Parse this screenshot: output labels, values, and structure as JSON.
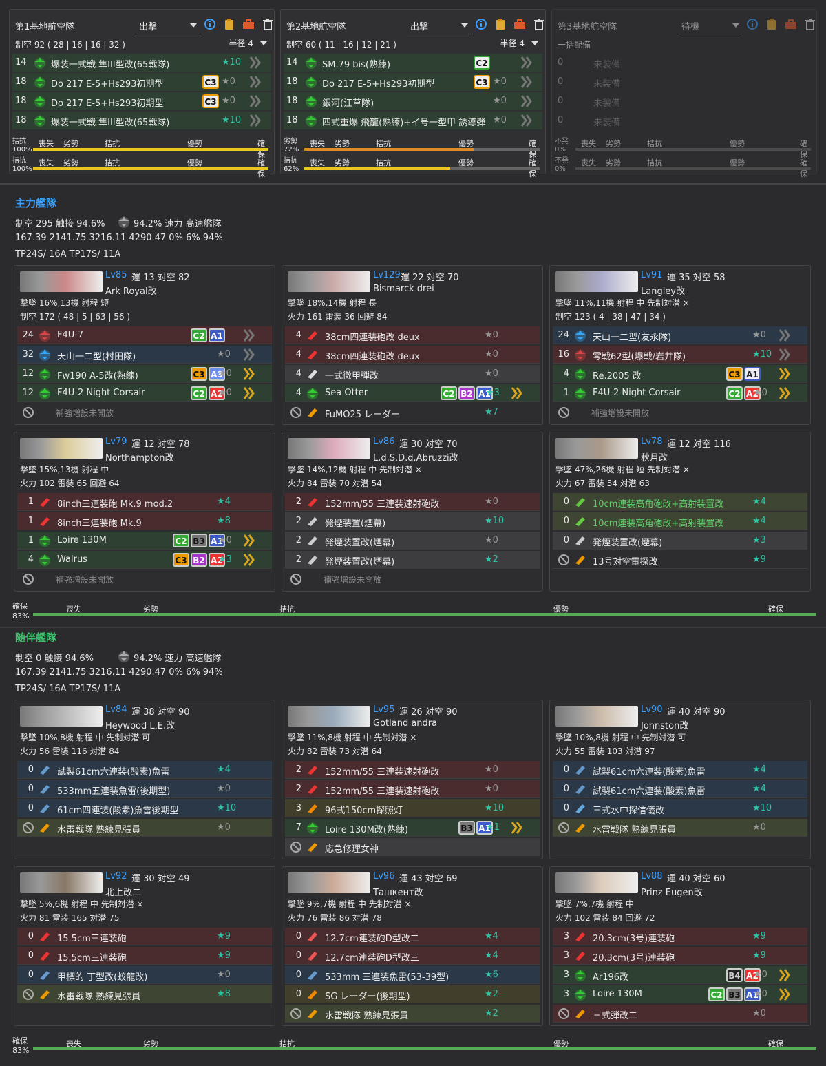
{
  "land_bases": [
    {
      "title": "第1基地航空隊",
      "mode": "出撃",
      "air": "制空 92 ( 28 | 16 | 16 | 32 )",
      "radius": "半径 4",
      "rows": [
        {
          "n": "14",
          "name": "爆装一式戦 隼III型改(65戦隊)",
          "star": "★10",
          "tone": "green",
          "star_color": "#2ec4a5",
          "badges": [],
          "chev": "grey"
        },
        {
          "n": "18",
          "name": "Do 217 E-5+Hs293初期型",
          "star": "★0",
          "tone": "green",
          "star_color": "#999",
          "badges": [
            "C3w"
          ],
          "chev": "grey"
        },
        {
          "n": "18",
          "name": "Do 217 E-5+Hs293初期型",
          "star": "★0",
          "tone": "green",
          "star_color": "#999",
          "badges": [
            "C3w"
          ],
          "chev": "grey"
        },
        {
          "n": "18",
          "name": "爆装一式戦 隼III型改(65戦隊)",
          "star": "★10",
          "tone": "green",
          "star_color": "#2ec4a5",
          "badges": [],
          "chev": "grey"
        }
      ],
      "bars": [
        {
          "label1": "拮抗",
          "label2": "100%",
          "pct": "100%"
        },
        {
          "label1": "拮抗",
          "label2": "100%",
          "pct": "100%"
        }
      ]
    },
    {
      "title": "第2基地航空隊",
      "mode": "出撃",
      "air": "制空 60 ( 11 | 16 | 12 | 21 )",
      "radius": "半径 4",
      "rows": [
        {
          "n": "14",
          "name": "SM.79 bis(熟練)",
          "star": "",
          "tone": "green",
          "star_color": "#999",
          "badges": [
            "C2w"
          ],
          "chev": "grey"
        },
        {
          "n": "18",
          "name": "Do 217 E-5+Hs293初期型",
          "star": "★0",
          "tone": "green",
          "star_color": "#999",
          "badges": [
            "C3w"
          ],
          "chev": "grey"
        },
        {
          "n": "18",
          "name": "銀河(江草隊)",
          "star": "★0",
          "tone": "green",
          "star_color": "#999",
          "badges": [],
          "chev": "grey"
        },
        {
          "n": "18",
          "name": "四式重爆 飛龍(熟練)+イ号一型甲 誘導弾",
          "star": "★0",
          "tone": "green",
          "star_color": "#999",
          "badges": [],
          "chev": "grey"
        }
      ],
      "bars": [
        {
          "label1": "劣勢",
          "label2": "72%",
          "pct": "72%"
        },
        {
          "label1": "拮抗",
          "label2": "62%",
          "pct": "62%"
        }
      ]
    },
    {
      "title": "第3基地航空隊",
      "mode": "待機",
      "air": "一括配備",
      "radius": "",
      "rows": [
        {
          "n": "0",
          "name": "未装備"
        },
        {
          "n": "0",
          "name": "未装備"
        },
        {
          "n": "0",
          "name": "未装備"
        },
        {
          "n": "0",
          "name": "未装備"
        }
      ],
      "bars": [
        {
          "label1": "不発",
          "label2": "0%",
          "pct": "0%"
        },
        {
          "label1": "不発",
          "label2": "0%",
          "pct": "0%"
        }
      ]
    }
  ],
  "bar_ticks": [
    "喪失",
    "劣勢",
    "拮抗",
    "優勢",
    "確保"
  ],
  "fleets": [
    {
      "title": "主力艦隊",
      "line1": "制空 295  触接 94.6%",
      "line1b": "94.2%  速力 高速艦隊",
      "line2": "167.39  2141.75  3216.11  4290.47    0%    6%    94%",
      "line3": "TP24S/ 16A   TP17S/ 11A",
      "bar_label1": "確保",
      "bar_label2": "83%",
      "ships": [
        {
          "lv": "Lv85",
          "stat": "運 13  対空 82",
          "name": "Ark Royal改",
          "l3": "撃墜 16%,13機  射程 短",
          "l4": "制空 172 ( 48 | 5 | 63 | 56 )",
          "pcolor": "#c88",
          "slots": [
            {
              "n": "24",
              "name": "F4U-7",
              "tone": "red",
              "star": "",
              "badges": [
                "C2",
                "A1"
              ],
              "chev": "grey",
              "ic": "#d44"
            },
            {
              "n": "32",
              "name": "天山一二型(村田隊)",
              "tone": "blue",
              "star": "★0",
              "badges": [],
              "chev": "grey",
              "ic": "#3af"
            },
            {
              "n": "12",
              "name": "Fw190 A-5改(熟練)",
              "tone": "green",
              "star": "★0",
              "badges": [
                "C3",
                "A3"
              ],
              "chev": "gold",
              "ic": "#3c3"
            },
            {
              "n": "12",
              "name": "F4U-2 Night Corsair",
              "tone": "green",
              "star": "★0",
              "badges": [
                "C2",
                "A2"
              ],
              "chev": "gold",
              "ic": "#3c3"
            }
          ],
          "ex": "補強増設未開放"
        },
        {
          "lv": "Lv129",
          "stat": "運 22  対空 70",
          "name": "Bismarck drei",
          "l3": "撃墜 18%,14機  射程 長",
          "l4": "火力 161  雷装 36  回避 84",
          "pcolor": "#caa",
          "slots": [
            {
              "n": "4",
              "name": "38cm四連装砲改 deux",
              "tone": "red",
              "star": "★0",
              "badges": [],
              "chev": "",
              "ic": "#e33"
            },
            {
              "n": "4",
              "name": "38cm四連装砲改 deux",
              "tone": "red",
              "star": "★0",
              "badges": [],
              "chev": "",
              "ic": "#e33"
            },
            {
              "n": "4",
              "name": "一式徹甲弾改",
              "tone": "grey",
              "star": "★0",
              "badges": [],
              "chev": "",
              "ic": "#ddd"
            },
            {
              "n": "4",
              "name": "Sea Otter",
              "tone": "green",
              "star": "★3",
              "badges": [
                "C2",
                "B2",
                "A1"
              ],
              "chev": "gold",
              "ic": "#3c3"
            }
          ],
          "ex_name": "FuMO25 レーダー",
          "ex_star": "★7"
        },
        {
          "lv": "Lv91",
          "stat": "運 35  対空 58",
          "name": "Langley改",
          "l3": "撃墜 11%,11機  射程 中  先制対潜 ×",
          "l4": "制空 123 ( 4 | 38 | 47 | 34 )",
          "pcolor": "#aac",
          "slots": [
            {
              "n": "24",
              "name": "天山一二型(友永隊)",
              "tone": "blue",
              "star": "★0",
              "badges": [],
              "chev": "grey",
              "ic": "#3af"
            },
            {
              "n": "16",
              "name": "零戦62型(爆戦/岩井隊)",
              "tone": "red",
              "star": "★10",
              "badges": [],
              "chev": "grey",
              "ic": "#d44"
            },
            {
              "n": "4",
              "name": "Re.2005 改",
              "tone": "green",
              "star": "",
              "badges": [
                "C3",
                "A1w"
              ],
              "chev": "gold",
              "ic": "#3c3"
            },
            {
              "n": "1",
              "name": "F4U-2 Night Corsair",
              "tone": "green",
              "star": "★0",
              "badges": [
                "C2",
                "A2"
              ],
              "chev": "gold",
              "ic": "#3c3"
            }
          ],
          "ex": "補強増設未開放"
        },
        {
          "lv": "Lv79",
          "stat": "運 12  対空 78",
          "name": "Northampton改",
          "l3": "撃墜 15%,13機  射程 中",
          "l4": "火力 102  雷装 65  回避 64",
          "pcolor": "#dc9",
          "slots": [
            {
              "n": "1",
              "name": "8inch三連装砲 Mk.9 mod.2",
              "tone": "red",
              "star": "★4",
              "badges": [],
              "chev": "",
              "ic": "#e33"
            },
            {
              "n": "1",
              "name": "8inch三連装砲 Mk.9",
              "tone": "red",
              "star": "★8",
              "badges": [],
              "chev": "",
              "ic": "#e33"
            },
            {
              "n": "1",
              "name": "Loire 130M",
              "tone": "green",
              "star": "★0",
              "badges": [
                "C2",
                "B3",
                "A1"
              ],
              "chev": "gold",
              "ic": "#3c3"
            },
            {
              "n": "4",
              "name": "Walrus",
              "tone": "green",
              "star": "★3",
              "badges": [
                "C3",
                "B2",
                "A2"
              ],
              "chev": "gold",
              "ic": "#3c3"
            }
          ],
          "ex": "補強増設未開放"
        },
        {
          "lv": "Lv86",
          "stat": "運 30  対空 70",
          "name": "L.d.S.D.d.Abruzzi改",
          "l3": "撃墜 14%,12機  射程 中  先制対潜 ×",
          "l4": "火力 84  雷装 70  対潜 54",
          "pcolor": "#dab",
          "slots": [
            {
              "n": "2",
              "name": "152mm/55 三連装速射砲改",
              "tone": "red",
              "star": "★0",
              "badges": [],
              "chev": "",
              "ic": "#e33"
            },
            {
              "n": "2",
              "name": "発煙装置(煙幕)",
              "tone": "grey",
              "star": "★10",
              "badges": [],
              "chev": "",
              "ic": "#ccc"
            },
            {
              "n": "2",
              "name": "発煙装置改(煙幕)",
              "tone": "grey",
              "star": "★0",
              "badges": [],
              "chev": "",
              "ic": "#ccc"
            },
            {
              "n": "2",
              "name": "発煙装置改(煙幕)",
              "tone": "grey",
              "star": "★2",
              "badges": [],
              "chev": "",
              "ic": "#ccc"
            }
          ],
          "ex": "補強増設未開放"
        },
        {
          "lv": "Lv78",
          "stat": "運 12  対空 116",
          "name": "秋月改",
          "l3": "撃墜 47%,26機  射程 短  先制対潜 ×",
          "l4": "火力 67  雷装 54  対潜 63",
          "pcolor": "#a98",
          "slots": [
            {
              "n": "0",
              "name": "10cm連装高角砲改+高射装置改",
              "tone": "olive",
              "star": "★4",
              "badges": [],
              "chev": "",
              "ic": "#6c4",
              "green": true
            },
            {
              "n": "0",
              "name": "10cm連装高角砲改+高射装置改",
              "tone": "olive",
              "star": "★4",
              "badges": [],
              "chev": "",
              "ic": "#6c4",
              "green": true
            },
            {
              "n": "0",
              "name": "発煙装置改(煙幕)",
              "tone": "grey",
              "star": "★3",
              "badges": [],
              "chev": "",
              "ic": "#ccc"
            }
          ],
          "ex_name": "13号対空電探改",
          "ex_star": "★9"
        }
      ]
    },
    {
      "title": "随伴艦隊",
      "line1": "制空 0  触接 94.6%",
      "line1b": "94.2%  速力 高速艦隊",
      "line2": "167.39  2141.75  3216.11  4290.47    0%    6%    94%",
      "line3": "TP24S/ 16A   TP17S/ 11A",
      "bar_label1": "確保",
      "bar_label2": "83%",
      "ships": [
        {
          "lv": "Lv84",
          "stat": "運 38  対空 90",
          "name": "Heywood L.E.改",
          "l3": "撃墜 10%,8機  射程 中  先制対潜 可",
          "l4": "火力 56  雷装 116  対潜 84",
          "pcolor": "#bbb",
          "slots": [
            {
              "n": "0",
              "name": "試製61cm六連装(酸素)魚雷",
              "tone": "blue",
              "star": "★4",
              "badges": [],
              "chev": "",
              "ic": "#69c"
            },
            {
              "n": "0",
              "name": "533mm五連装魚雷(後期型)",
              "tone": "blue",
              "star": "★0",
              "badges": [],
              "chev": "",
              "ic": "#69c"
            },
            {
              "n": "0",
              "name": "61cm四連装(酸素)魚雷後期型",
              "tone": "blue",
              "star": "★10",
              "badges": [],
              "chev": "",
              "ic": "#69c"
            }
          ],
          "ex_name": "水雷戦隊 熟練見張員",
          "ex_star": "★0",
          "ex_tone": "olive"
        },
        {
          "lv": "Lv95",
          "stat": "運 26  対空 90",
          "name": "Gotland andra",
          "l3": "撃墜 11%,8機  射程 中  先制対潜 ×",
          "l4": "火力 82  雷装 73  対潜 64",
          "pcolor": "#9ab",
          "slots": [
            {
              "n": "2",
              "name": "152mm/55 三連装速射砲改",
              "tone": "red",
              "star": "★0",
              "badges": [],
              "chev": "",
              "ic": "#e33"
            },
            {
              "n": "2",
              "name": "152mm/55 三連装速射砲改",
              "tone": "red",
              "star": "★0",
              "badges": [],
              "chev": "",
              "ic": "#e33"
            },
            {
              "n": "3",
              "name": "96式150cm探照灯",
              "tone": "yel",
              "star": "★10",
              "badges": [],
              "chev": "",
              "ic": "#e80"
            },
            {
              "n": "7",
              "name": "Loire 130M改(熟練)",
              "tone": "green",
              "star": "★1",
              "badges": [
                "B3",
                "A1"
              ],
              "chev": "gold",
              "ic": "#3c3"
            }
          ],
          "ex_name": "応急修理女神",
          "ex_star": "",
          "ex_tone": "grey"
        },
        {
          "lv": "Lv90",
          "stat": "運 40  対空 90",
          "name": "Johnston改",
          "l3": "撃墜 10%,8機  射程 中  先制対潜 可",
          "l4": "火力 55  雷装 103  対潜 97",
          "pcolor": "#cba",
          "slots": [
            {
              "n": "0",
              "name": "試製61cm六連装(酸素)魚雷",
              "tone": "blue",
              "star": "★4",
              "badges": [],
              "chev": "",
              "ic": "#69c"
            },
            {
              "n": "0",
              "name": "試製61cm六連装(酸素)魚雷",
              "tone": "blue",
              "star": "★4",
              "badges": [],
              "chev": "",
              "ic": "#69c"
            },
            {
              "n": "0",
              "name": "三式水中探信儀改",
              "tone": "blue",
              "star": "★10",
              "badges": [],
              "chev": "",
              "ic": "#6ad"
            }
          ],
          "ex_name": "水雷戦隊 熟練見張員",
          "ex_star": "★0",
          "ex_tone": "olive"
        },
        {
          "lv": "Lv92",
          "stat": "運 30  対空 49",
          "name": "北上改二",
          "l3": "撃墜 5%,6機  射程 中  先制対潜 ×",
          "l4": "火力 81  雷装 165  対潜 75",
          "pcolor": "#876",
          "slots": [
            {
              "n": "0",
              "name": "15.5cm三連装砲",
              "tone": "red",
              "star": "★9",
              "badges": [],
              "chev": "",
              "ic": "#e33"
            },
            {
              "n": "0",
              "name": "15.5cm三連装砲",
              "tone": "red",
              "star": "★9",
              "badges": [],
              "chev": "",
              "ic": "#e33"
            },
            {
              "n": "0",
              "name": "甲標的 丁型改(蛟龍改)",
              "tone": "blue",
              "star": "★0",
              "badges": [],
              "chev": "",
              "ic": "#69c"
            }
          ],
          "ex_name": "水雷戦隊 熟練見張員",
          "ex_star": "★8",
          "ex_tone": "olive"
        },
        {
          "lv": "Lv96",
          "stat": "運 43  対空 69",
          "name": "Ташкент改",
          "l3": "撃墜 9%,7機  射程 中  先制対潜 ×",
          "l4": "火力 76  雷装 86  対潜 78",
          "pcolor": "#ca9",
          "slots": [
            {
              "n": "0",
              "name": "12.7cm連装砲D型改二",
              "tone": "red",
              "star": "★4",
              "badges": [],
              "chev": "",
              "ic": "#e55"
            },
            {
              "n": "0",
              "name": "12.7cm連装砲D型改三",
              "tone": "red",
              "star": "★4",
              "badges": [],
              "chev": "",
              "ic": "#e55"
            },
            {
              "n": "0",
              "name": "533mm 三連装魚雷(53-39型)",
              "tone": "blue",
              "star": "★6",
              "badges": [],
              "chev": "",
              "ic": "#69c"
            },
            {
              "n": "0",
              "name": "SG レーダー(後期型)",
              "tone": "yel",
              "star": "★2",
              "badges": [],
              "chev": "",
              "ic": "#e80"
            }
          ],
          "ex_name": "水雷戦隊 熟練見張員",
          "ex_star": "★2",
          "ex_tone": "olive"
        },
        {
          "lv": "Lv88",
          "stat": "運 40  対空 60",
          "name": "Prinz Eugen改",
          "l3": "撃墜 7%,7機  射程 中",
          "l4": "火力 102  雷装 84  回避 72",
          "pcolor": "#dcb",
          "slots": [
            {
              "n": "3",
              "name": "20.3cm(3号)連装砲",
              "tone": "red",
              "star": "★9",
              "badges": [],
              "chev": "",
              "ic": "#e33"
            },
            {
              "n": "3",
              "name": "20.3cm(3号)連装砲",
              "tone": "red",
              "star": "★9",
              "badges": [],
              "chev": "",
              "ic": "#e33"
            },
            {
              "n": "3",
              "name": "Ar196改",
              "tone": "green",
              "star": "★0",
              "badges": [
                "B4",
                "A2"
              ],
              "chev": "gold",
              "ic": "#3c3"
            },
            {
              "n": "3",
              "name": "Loire 130M",
              "tone": "green",
              "star": "★0",
              "badges": [
                "C2",
                "B3",
                "A1"
              ],
              "chev": "gold",
              "ic": "#3c3"
            }
          ],
          "ex_name": "三式弾改二",
          "ex_star": "★0",
          "ex_tone": "red"
        }
      ]
    }
  ]
}
